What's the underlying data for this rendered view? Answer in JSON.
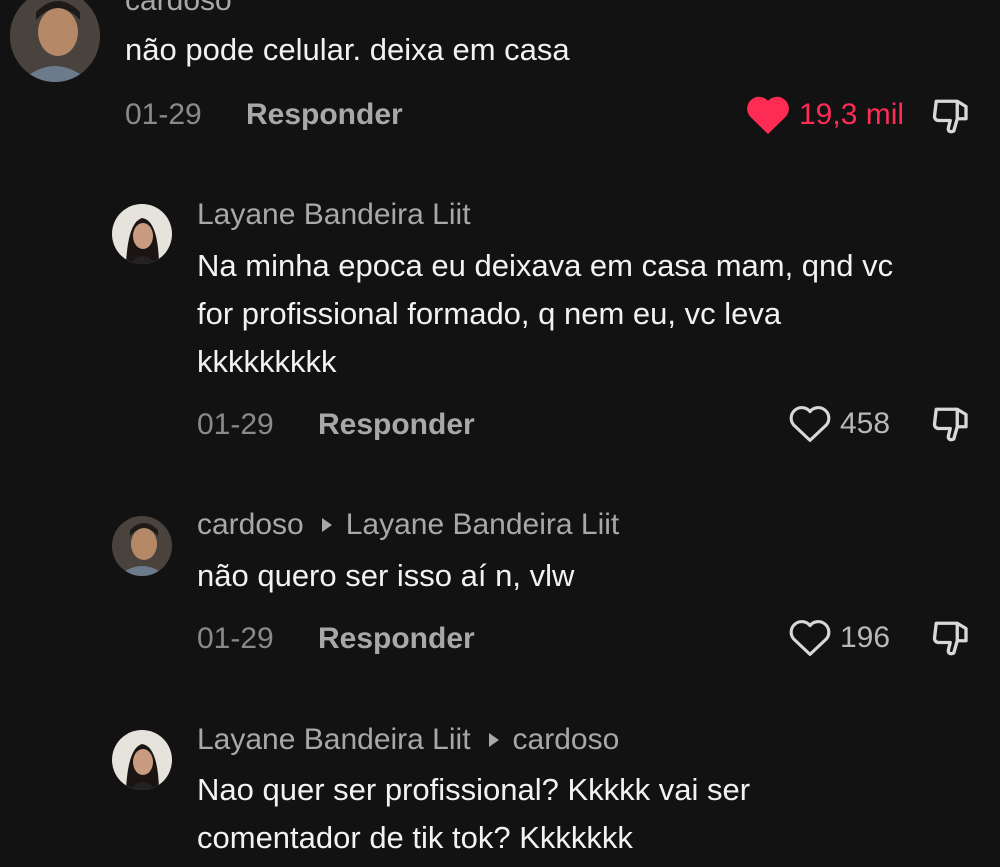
{
  "comments": [
    {
      "username": "cardoso",
      "reply_to": "",
      "text": "não pode celular. deixa em casa",
      "date": "01-29",
      "reply_label": "Responder",
      "likes": "19,3 mil",
      "liked": true
    },
    {
      "username": "Layane Bandeira Liit",
      "reply_to": "",
      "text_lines": [
        "Na minha epoca eu deixava em casa mam, qnd vc",
        "for profissional formado, q nem eu, vc leva",
        "kkkkkkkkk"
      ],
      "date": "01-29",
      "reply_label": "Responder",
      "likes": "458",
      "liked": false
    },
    {
      "username": "cardoso",
      "reply_to": "Layane Bandeira Liit",
      "text": "não quero ser isso aí n, vlw",
      "date": "01-29",
      "reply_label": "Responder",
      "likes": "196",
      "liked": false
    },
    {
      "username": "Layane Bandeira Liit",
      "reply_to": "cardoso",
      "text_lines": [
        "Nao quer ser profissional? Kkkkk vai ser",
        "comentador de tik tok? Kkkkkkk"
      ]
    }
  ],
  "colors": {
    "background": "#121212",
    "liked_heart": "#fe2c55",
    "text": "#f2f2f2",
    "muted": "#a8a8a8"
  },
  "icons": {
    "like": "heart-icon",
    "dislike": "thumbs-down-icon",
    "reply_arrow": "triangle-right-icon"
  }
}
